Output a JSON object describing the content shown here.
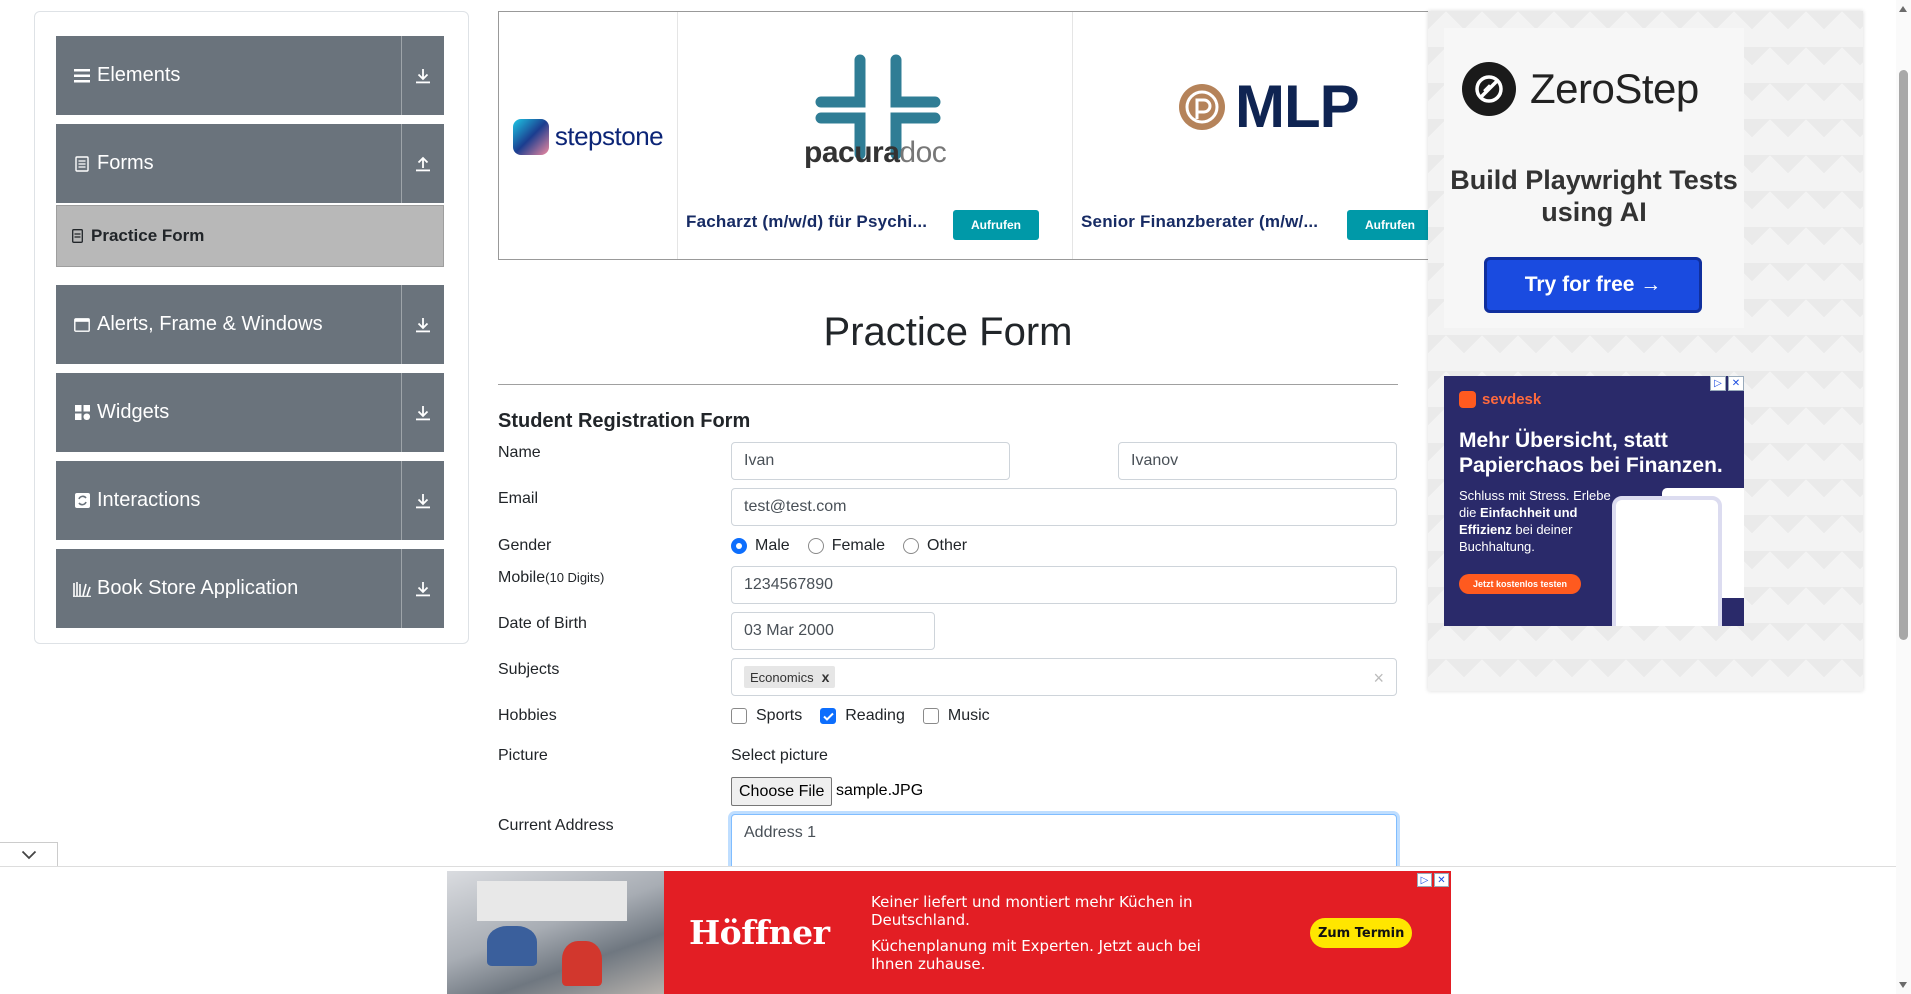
{
  "sidebar": {
    "groups": [
      {
        "label": "Elements",
        "icon": "hamburger-icon",
        "state": "collapsed"
      },
      {
        "label": "Forms",
        "icon": "document-icon",
        "state": "expanded"
      },
      {
        "label": "Alerts, Frame & Windows",
        "icon": "window-icon",
        "state": "collapsed"
      },
      {
        "label": "Widgets",
        "icon": "widgets-icon",
        "state": "collapsed"
      },
      {
        "label": "Interactions",
        "icon": "interactions-icon",
        "state": "collapsed"
      },
      {
        "label": "Book Store Application",
        "icon": "books-icon",
        "state": "collapsed"
      }
    ],
    "active_item": {
      "label": "Practice Form",
      "icon": "form-icon"
    }
  },
  "jobs_ad": {
    "brand": "stepstone",
    "jobs": [
      {
        "logo_text": "pacura",
        "logo_text_2": "doc",
        "title": "Facharzt (m/w/d) für Psychi...",
        "button": "Aufrufen"
      },
      {
        "logo_text": "MLP",
        "title": "Senior Finanzberater (m/w/...",
        "button": "Aufrufen"
      }
    ]
  },
  "page_title": "Practice Form",
  "form": {
    "title": "Student Registration Form",
    "name_label": "Name",
    "first_name": "Ivan",
    "last_name": "Ivanov",
    "email_label": "Email",
    "email": "test@test.com",
    "gender_label": "Gender",
    "gender_options": [
      "Male",
      "Female",
      "Other"
    ],
    "gender_selected": "Male",
    "mobile_label": "Mobile",
    "mobile_hint": "(10 Digits)",
    "mobile": "1234567890",
    "dob_label": "Date of Birth",
    "dob": "03 Mar 2000",
    "subjects_label": "Subjects",
    "subjects": [
      "Economics"
    ],
    "subject_remove": "x",
    "subjects_clear": "×",
    "hobbies_label": "Hobbies",
    "hobbies": [
      {
        "label": "Sports",
        "checked": false
      },
      {
        "label": "Reading",
        "checked": true
      },
      {
        "label": "Music",
        "checked": false
      }
    ],
    "picture_label": "Picture",
    "picture_hint": "Select picture",
    "choose_file": "Choose File",
    "file_name": "sample.JPG",
    "address_label": "Current Address",
    "address": "Address 1"
  },
  "ads": {
    "zerostep": {
      "brand": "ZeroStep",
      "tagline": "Build Playwright Tests using AI",
      "button": "Try for free →"
    },
    "sevdesk": {
      "brand": "sevdesk",
      "headline": "Mehr Übersicht, statt Papierchaos bei Finanzen.",
      "body_1": "Schluss mit Stress. Erlebe die",
      "body_bold": "Einfachheit und Effizienz",
      "body_2": "bei deiner Buchhaltung.",
      "button": "Jetzt kostenlos testen"
    },
    "hoffner": {
      "brand": "Höffner",
      "line_1": "Keiner liefert und montiert mehr Küchen in Deutschland.",
      "line_2": "Küchenplanung mit Experten. Jetzt auch bei Ihnen zuhause.",
      "button": "Zum Termin"
    }
  },
  "colors": {
    "sidebar_group": "#6a737c",
    "sidebar_active": "#b8b8b8",
    "primary": "#0d6efd",
    "job_button": "#0099a8",
    "hoffner_red": "#e31e24",
    "zerostep_button": "#1a4be0"
  }
}
